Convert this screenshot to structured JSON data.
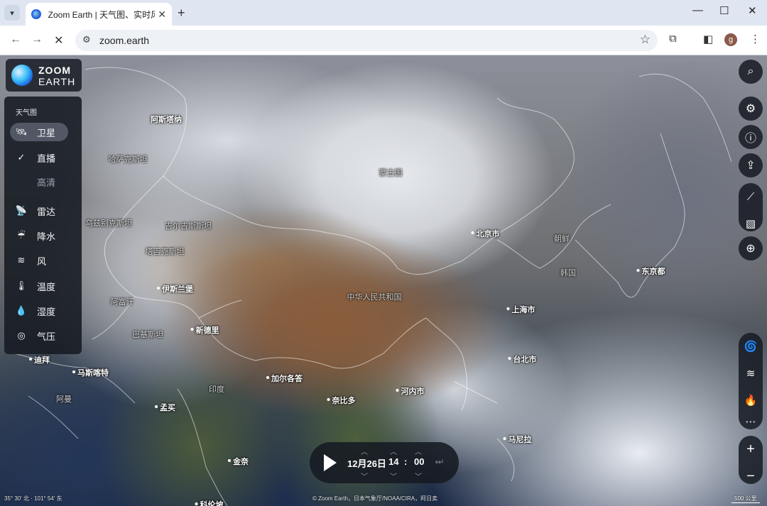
{
  "browser": {
    "tab_title": "Zoom Earth | 天气图、实时风暴",
    "tab_close": "✕",
    "new_tab": "+",
    "url": "zoom.earth",
    "window_controls": [
      "—",
      "☐",
      "✕"
    ],
    "profile_initial": "g"
  },
  "logo": {
    "line1": "ZOOM",
    "line2": "EARTH"
  },
  "layers": {
    "heading": "天气图",
    "items": [
      {
        "label": "卫星",
        "icon": "satellite-icon",
        "active": true
      },
      {
        "label": "直播",
        "icon": "check-icon",
        "sub": true
      },
      {
        "label": "高清",
        "icon": "",
        "sub": true,
        "muted": true
      },
      {
        "label": "雷达",
        "icon": "radar-icon"
      },
      {
        "label": "降水",
        "icon": "precipitation-icon"
      },
      {
        "label": "风",
        "icon": "wind-icon"
      },
      {
        "label": "温度",
        "icon": "thermometer-icon"
      },
      {
        "label": "湿度",
        "icon": "humidity-icon"
      },
      {
        "label": "气压",
        "icon": "pressure-icon"
      }
    ]
  },
  "places": [
    {
      "name": "阿斯塔纳"
    },
    {
      "name": "哈萨克斯坦"
    },
    {
      "name": "蒙古国"
    },
    {
      "name": "乌兹别克斯坦"
    },
    {
      "name": "吉尔吉斯斯坦"
    },
    {
      "name": "塔吉克斯坦"
    },
    {
      "name": "伊斯兰堡"
    },
    {
      "name": "阿富汗"
    },
    {
      "name": "巴基斯坦"
    },
    {
      "name": "新德里"
    },
    {
      "name": "迪拜"
    },
    {
      "name": "马斯喀特"
    },
    {
      "name": "阿曼"
    },
    {
      "name": "印度"
    },
    {
      "name": "孟买"
    },
    {
      "name": "加尔各答"
    },
    {
      "name": "金奈"
    },
    {
      "name": "科伦坡"
    },
    {
      "name": "中华人民共和国"
    },
    {
      "name": "北京市"
    },
    {
      "name": "朝鲜"
    },
    {
      "name": "韩国"
    },
    {
      "name": "东京都"
    },
    {
      "name": "上海市"
    },
    {
      "name": "台北市"
    },
    {
      "name": "河内市"
    },
    {
      "name": "奈比多"
    },
    {
      "name": "马尼拉"
    }
  ],
  "time": {
    "date": "12月26日",
    "hour": "14",
    "sep": ":",
    "minute": "00"
  },
  "credit": "© Zoom Earth，日本气象厅/NOAA/CIRA，阿日卖",
  "coords": "35° 30' 北 · 101° 54' 东",
  "scale": "500 公里",
  "colors": {
    "panel": "#16191f",
    "accent": "#38bdf8"
  }
}
